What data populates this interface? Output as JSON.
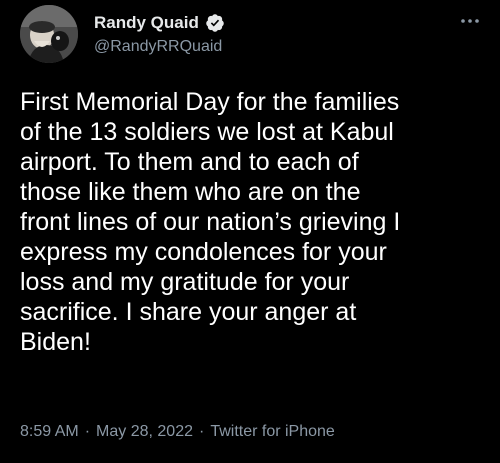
{
  "author": {
    "display_name": "Randy Quaid",
    "handle": "@RandyRRQuaid",
    "avatar_icon": "avatar-photo",
    "verified_icon": "verified-badge-icon"
  },
  "more_icon": "more-options-icon",
  "tweet": {
    "text": "First Memorial Day for the families\nof the 13 soldiers we lost at Kabul\nairport. To them and to each of\nthose like them who are on the\nfront lines of our nation’s grieving I\nexpress my condolences for your\nloss and my gratitude for your\nsacrifice. I share your anger at\nBiden!"
  },
  "meta": {
    "time": "8:59 AM",
    "separator": "·",
    "date": "May 28, 2022",
    "source": "Twitter for iPhone"
  },
  "colors": {
    "background": "#000000",
    "text": "#ffffff",
    "secondary": "#8b98a5",
    "verified": "#e7e9ea"
  }
}
